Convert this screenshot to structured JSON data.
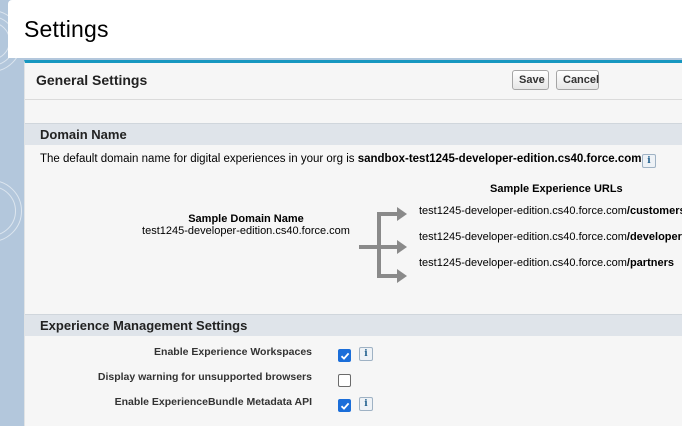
{
  "page": {
    "title": "Settings"
  },
  "panel": {
    "title": "General Settings",
    "save_label": "Save",
    "cancel_label": "Cancel"
  },
  "domain_section": {
    "title": "Domain Name",
    "description_prefix": "The default domain name for digital experiences in your org is ",
    "default_domain": "sandbox-test1245-developer-edition.cs40.force.com",
    "sample_urls_heading": "Sample Experience URLs",
    "sample_domain_heading": "Sample Domain Name",
    "sample_domain_value": "test1245-developer-edition.cs40.force.com",
    "urls": [
      {
        "base": "test1245-developer-edition.cs40.force.com",
        "path": "/customers"
      },
      {
        "base": "test1245-developer-edition.cs40.force.com",
        "path": "/developers"
      },
      {
        "base": "test1245-developer-edition.cs40.force.com",
        "path": "/partners"
      }
    ]
  },
  "experience_section": {
    "title": "Experience Management Settings",
    "rows": [
      {
        "label": "Enable Experience Workspaces",
        "checked": true,
        "has_info": true
      },
      {
        "label": "Display warning for unsupported browsers",
        "checked": false,
        "has_info": false
      },
      {
        "label": "Enable ExperienceBundle Metadata API",
        "checked": true,
        "has_info": true
      }
    ]
  },
  "icons": {
    "info": "info-icon",
    "checkmark": "checkmark-icon",
    "arrow": "branch-arrow-icon"
  },
  "colors": {
    "accent": "#1797c0",
    "checkbox_checked": "#1b6ed9",
    "section_bar": "#dfe4ea",
    "background": "#b3c7dc"
  }
}
